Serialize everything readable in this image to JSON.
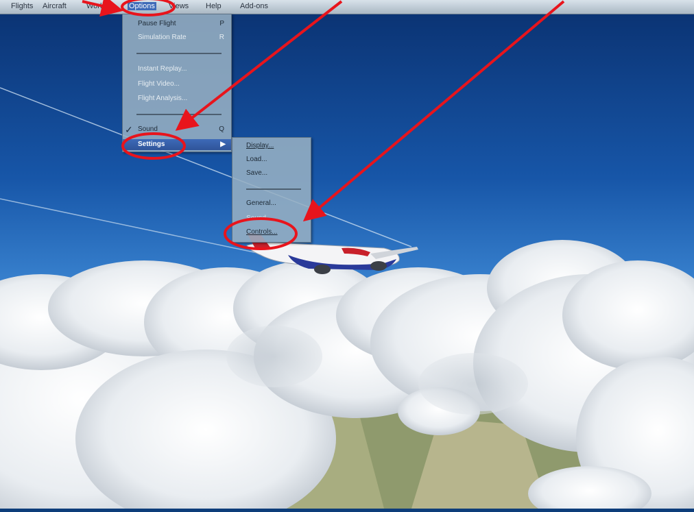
{
  "menubar": {
    "items": [
      "Flights",
      "Aircraft",
      "World",
      "Options",
      "Views",
      "Help",
      "Add-ons"
    ]
  },
  "options_menu": {
    "items": [
      {
        "label": "Pause Flight",
        "shortcut": "P"
      },
      {
        "label": "Simulation Rate",
        "shortcut": "R"
      },
      {
        "label": "Instant Replay..."
      },
      {
        "label": "Flight Video..."
      },
      {
        "label": "Flight Analysis..."
      },
      {
        "label": "Sound",
        "shortcut": "Q"
      },
      {
        "label": "Settings"
      }
    ]
  },
  "settings_submenu": {
    "items": [
      {
        "label": "Display..."
      },
      {
        "label": "Load..."
      },
      {
        "label": "Save..."
      },
      {
        "label": "General..."
      },
      {
        "label": "Sound..."
      },
      {
        "label": "Controls..."
      }
    ]
  },
  "colors": {
    "annotation": "#e8141c",
    "menu_highlight": "#3d6ab8",
    "sky_top": "#0a3a78",
    "sky_bottom": "#4b94da"
  },
  "icons": [
    "check-icon",
    "submenu-arrow-icon"
  ]
}
